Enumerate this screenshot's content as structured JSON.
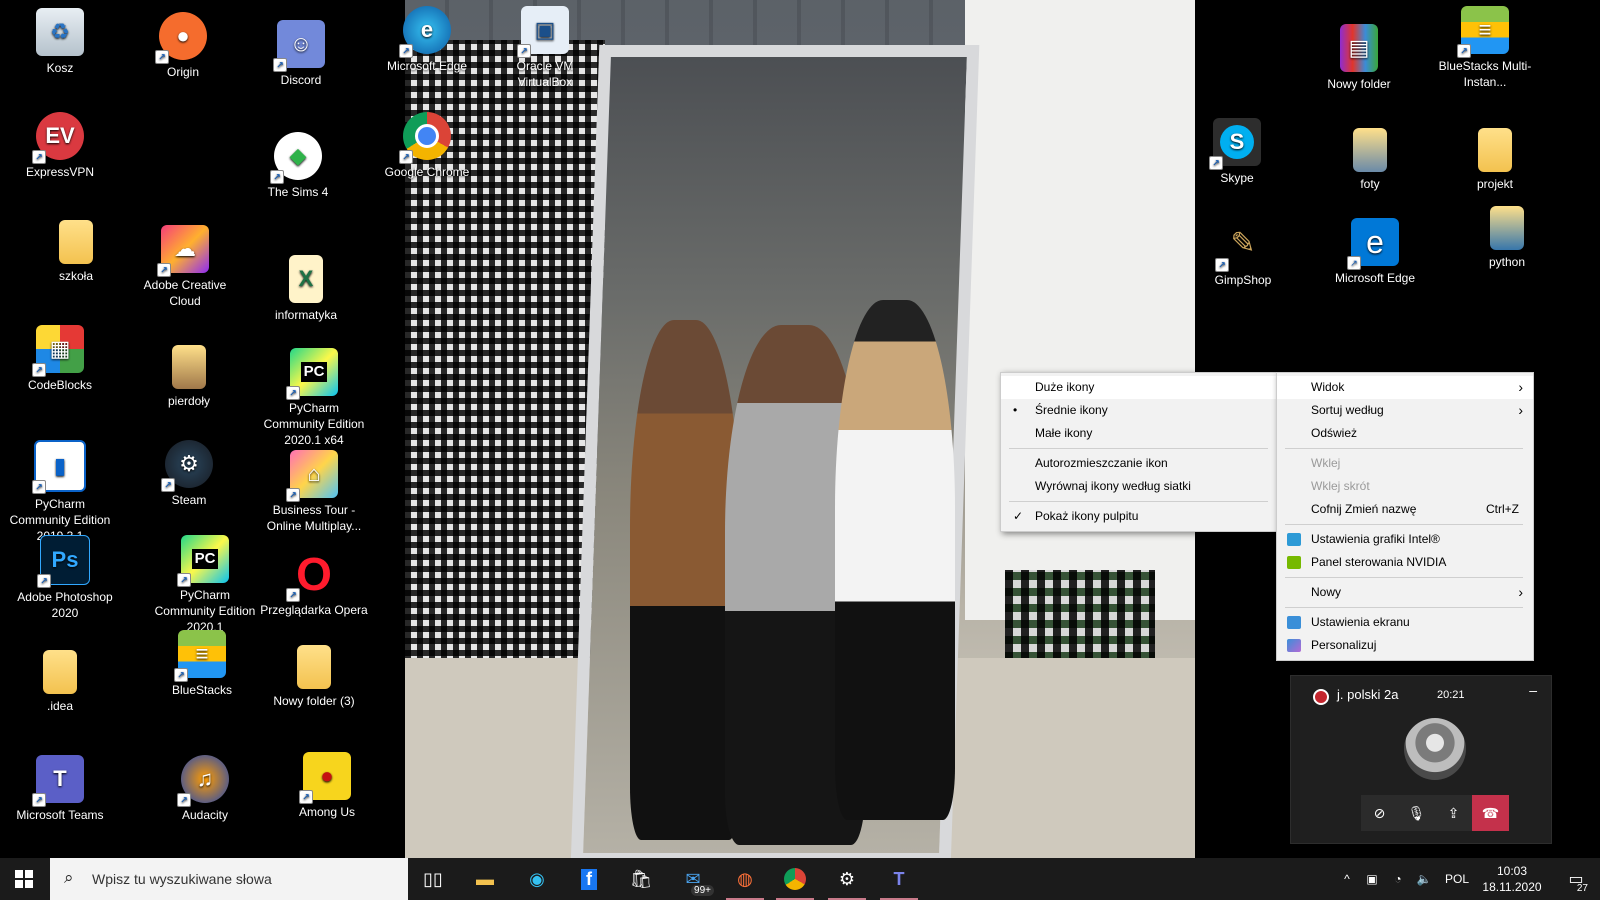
{
  "desktop": {
    "icons": [
      {
        "label": "Kosz",
        "icon": "recycle-bin-icon"
      },
      {
        "label": "Origin",
        "icon": "origin-icon"
      },
      {
        "label": "Discord",
        "icon": "discord-icon"
      },
      {
        "label": "Microsoft Edge",
        "icon": "edge-icon"
      },
      {
        "label": "Oracle VM VirtualBox",
        "icon": "virtualbox-icon"
      },
      {
        "label": "ExpressVPN",
        "icon": "expressvpn-icon"
      },
      {
        "label": "The Sims 4",
        "icon": "sims-icon"
      },
      {
        "label": "Google Chrome",
        "icon": "chrome-icon"
      },
      {
        "label": "szkoła",
        "icon": "folder-icon"
      },
      {
        "label": "Adobe Creative Cloud",
        "icon": "creative-cloud-icon"
      },
      {
        "label": "informatyka",
        "icon": "excel-file-icon"
      },
      {
        "label": "CodeBlocks",
        "icon": "codeblocks-icon"
      },
      {
        "label": "pierdoły",
        "icon": "folder-icon"
      },
      {
        "label": "PyCharm Community Edition 2020.1 x64",
        "icon": "pycharm-icon"
      },
      {
        "label": "PyCharm Community Edition 2019.3.1",
        "icon": "pycharm-old-icon"
      },
      {
        "label": "Steam",
        "icon": "steam-icon"
      },
      {
        "label": "Business Tour - Online Multiplay...",
        "icon": "business-tour-icon"
      },
      {
        "label": "Adobe Photoshop 2020",
        "icon": "photoshop-icon"
      },
      {
        "label": "PyCharm Community Edition 2020.1",
        "icon": "pycharm-icon"
      },
      {
        "label": "Przeglądarka Opera",
        "icon": "opera-icon"
      },
      {
        "label": ".idea",
        "icon": "folder-icon"
      },
      {
        "label": "BlueStacks",
        "icon": "bluestacks-icon"
      },
      {
        "label": "Nowy folder (3)",
        "icon": "folder-icon"
      },
      {
        "label": "Microsoft Teams",
        "icon": "teams-icon"
      },
      {
        "label": "Audacity",
        "icon": "audacity-icon"
      },
      {
        "label": "Among Us",
        "icon": "among-us-icon"
      },
      {
        "label": "Nowy folder",
        "icon": "winrar-icon"
      },
      {
        "label": "BlueStacks Multi-Instan...",
        "icon": "bluestacks-multi-icon"
      },
      {
        "label": "Skype",
        "icon": "skype-icon"
      },
      {
        "label": "foty",
        "icon": "folder-icon"
      },
      {
        "label": "projekt",
        "icon": "folder-icon"
      },
      {
        "label": "GimpShop",
        "icon": "gimp-icon"
      },
      {
        "label": "Microsoft Edge",
        "icon": "edge-legacy-icon"
      },
      {
        "label": "python",
        "icon": "folder-icon"
      }
    ]
  },
  "view_submenu": {
    "items": [
      {
        "label": "Duże ikony",
        "checked": ""
      },
      {
        "label": "Średnie ikony",
        "checked": "•"
      },
      {
        "label": "Małe ikony",
        "checked": ""
      },
      {
        "label": "Autorozmieszczanie ikon",
        "checked": ""
      },
      {
        "label": "Wyrównaj ikony według siatki",
        "checked": ""
      },
      {
        "label": "Pokaż ikony pulpitu",
        "checked": "✓"
      }
    ]
  },
  "context_menu": {
    "view": "Widok",
    "sort": "Sortuj według",
    "refresh": "Odśwież",
    "paste": "Wklej",
    "paste_shortcut": "Wklej skrót",
    "undo_rename": "Cofnij Zmień nazwę",
    "undo_shortcut": "Ctrl+Z",
    "intel": "Ustawienia grafiki Intel®",
    "nvidia": "Panel sterowania NVIDIA",
    "new": "Nowy",
    "display": "Ustawienia ekranu",
    "personalize": "Personalizuj"
  },
  "call": {
    "title": "j. polski 2a",
    "time": "20:21",
    "minimize": "–"
  },
  "taskbar": {
    "search_placeholder": "Wpisz tu wyszukiwane słowa",
    "mail_badge": "99+",
    "language": "POL",
    "clock_time": "10:03",
    "clock_date": "18.11.2020",
    "notifications": "27"
  },
  "colors": {
    "accent": "#0078d7",
    "call_end": "#c4314b",
    "taskbar": "#1b1b1b"
  }
}
